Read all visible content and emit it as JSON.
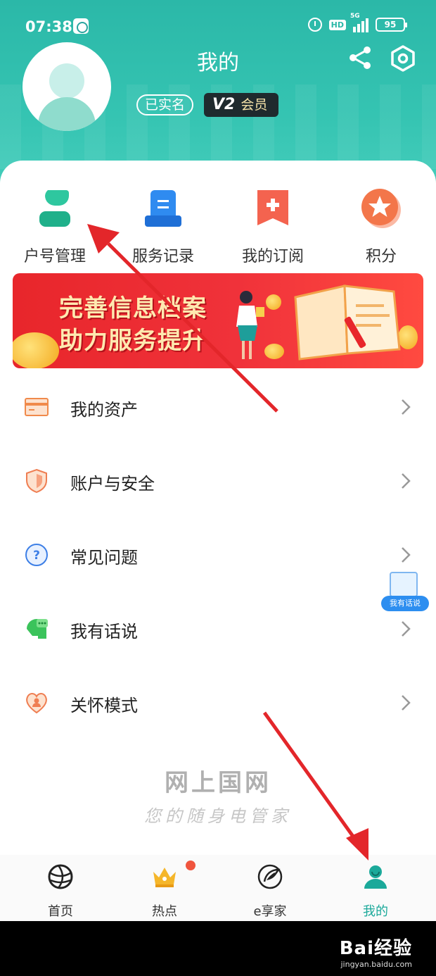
{
  "status_bar": {
    "time": "07:38",
    "hd": "HD",
    "network": "5G",
    "battery": "95"
  },
  "header": {
    "title": "我的",
    "verified_label": "已实名",
    "member_level": "V2",
    "member_label": "会员"
  },
  "quick_actions": [
    {
      "label": "户号管理",
      "icon": "account-user-icon"
    },
    {
      "label": "服务记录",
      "icon": "service-record-icon"
    },
    {
      "label": "我的订阅",
      "icon": "subscription-bookmark-icon"
    },
    {
      "label": "积分",
      "icon": "points-star-icon"
    }
  ],
  "banner": {
    "line1": "完善信息档案",
    "line2": "助力服务提升"
  },
  "menu": [
    {
      "label": "我的资产",
      "icon": "assets-card-icon"
    },
    {
      "label": "账户与安全",
      "icon": "shield-icon"
    },
    {
      "label": "常见问题",
      "icon": "question-icon"
    },
    {
      "label": "我有话说",
      "icon": "chat-head-icon"
    },
    {
      "label": "关怀模式",
      "icon": "care-heart-icon"
    }
  ],
  "floating_feedback": {
    "label": "我有话说"
  },
  "slogan": {
    "brand": "网上国网",
    "tagline": "您的随身电管家"
  },
  "tabbar": [
    {
      "label": "首页",
      "icon": "globe-icon"
    },
    {
      "label": "热点",
      "icon": "crown-icon"
    },
    {
      "label": "e享家",
      "icon": "e-leaf-icon"
    },
    {
      "label": "我的",
      "icon": "profile-icon",
      "active": true
    }
  ],
  "watermark": {
    "main": "Bai经验",
    "url": "jingyan.baidu.com"
  },
  "colors": {
    "primary": "#2bb8a8",
    "active_tab": "#1ba99a",
    "banner_red": "#e8262b",
    "annotation_arrow": "#e3262a"
  }
}
